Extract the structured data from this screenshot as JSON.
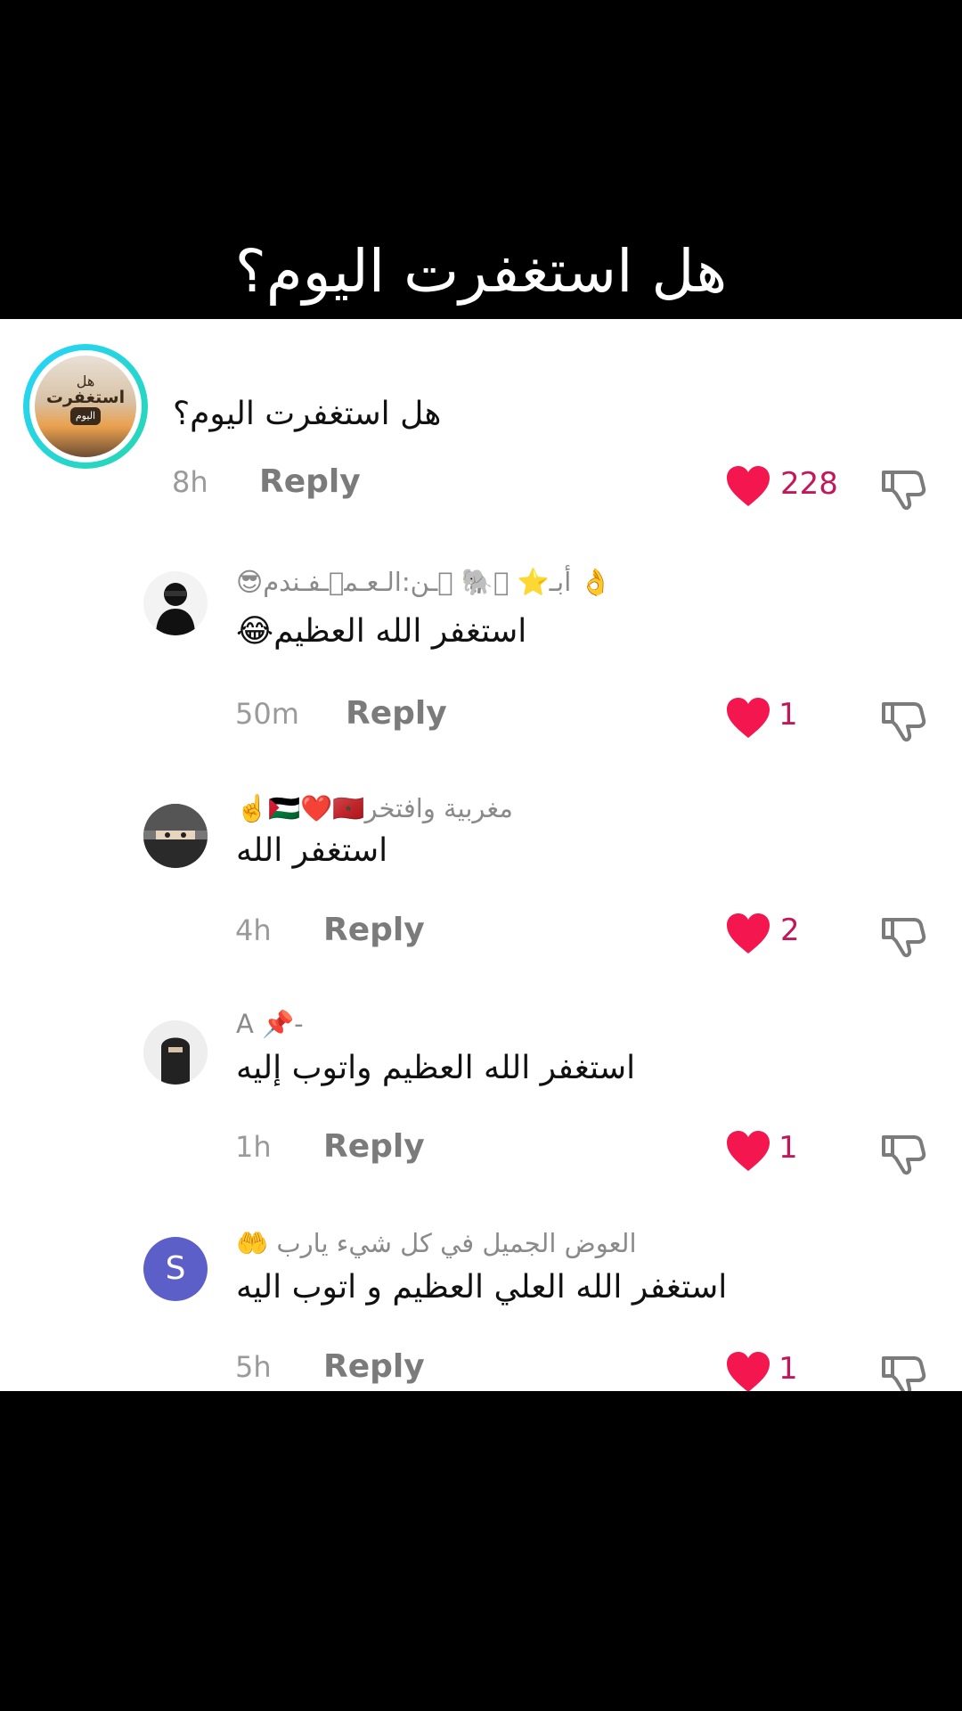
{
  "header": {
    "title": "هل استغفرت اليوم؟"
  },
  "main_comment": {
    "avatar": {
      "line1": "هل",
      "line2": "استغفرت",
      "badge": "اليوم"
    },
    "text": "هل استغفرت اليوم؟",
    "time": "8h",
    "reply_label": "Reply",
    "likes": "228"
  },
  "replies": [
    {
      "username": "👌 أبـ⭐ ⃟🐘 ⃟ـن:الـعـم⃟ـفـندم😎",
      "text": "استغفر الله العظيم😂",
      "time": "50m",
      "reply_label": "Reply",
      "likes": "1",
      "avatar_icon": "user-photo-avatar"
    },
    {
      "username": "مغربية وافتخر🇵🇸❤️🇲🇦☝️",
      "text": "استغفر الله",
      "time": "4h",
      "reply_label": "Reply",
      "likes": "2",
      "avatar_icon": "user-photo-avatar"
    },
    {
      "username": "A 📌-",
      "text": "استغفر الله العظيم واتوب إليه",
      "time": "1h",
      "reply_label": "Reply",
      "likes": "1",
      "avatar_icon": "user-photo-avatar"
    },
    {
      "username": "العوض الجميل في كل شيء يارب 🤲",
      "text": "استغفر الله العلي العظيم و اتوب اليه",
      "time": "5h",
      "reply_label": "Reply",
      "likes": "1",
      "avatar_letter": "S"
    }
  ],
  "colors": {
    "like": "#f4164f",
    "count": "#c2185b",
    "avatar_s": "#5b5fc7"
  }
}
